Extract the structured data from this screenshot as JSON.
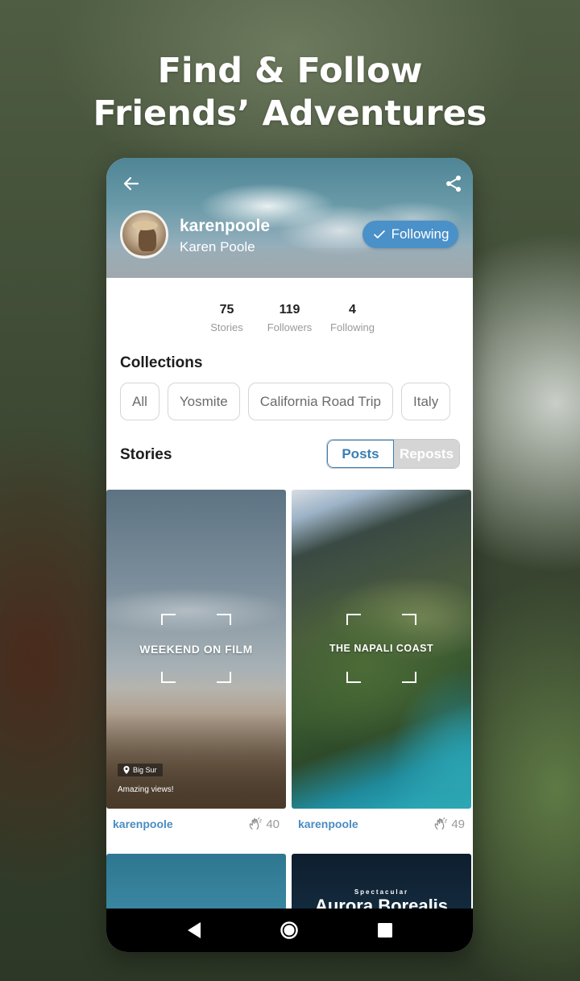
{
  "headline": {
    "line1": "Find & Follow",
    "line2": "Friends’ Adventures"
  },
  "profile": {
    "username": "karenpoole",
    "full_name": "Karen Poole",
    "follow_label": "Following"
  },
  "stats": [
    {
      "value": "75",
      "label": "Stories"
    },
    {
      "value": "119",
      "label": "Followers"
    },
    {
      "value": "4",
      "label": "Following"
    }
  ],
  "collections": {
    "title": "Collections",
    "items": [
      "All",
      "Yosmite",
      "California Road Trip",
      "Italy"
    ]
  },
  "stories": {
    "title": "Stories",
    "tab_posts": "Posts",
    "tab_reposts": "Reposts",
    "cards": [
      {
        "title": "WEEKEND ON FILM",
        "location": "Big Sur",
        "caption": "Amazing views!",
        "author": "karenpoole",
        "likes": "40"
      },
      {
        "title": "THE NAPALI COAST",
        "author": "karenpoole",
        "likes": "49"
      }
    ],
    "partial": {
      "kicker": "Spectacular",
      "title": "Aurora Borealis"
    }
  },
  "icons": {
    "back": "arrow-left-icon",
    "share": "share-icon",
    "check": "check-icon",
    "location": "location-pin-icon",
    "clap": "clap-icon",
    "nav_back": "triangle-back-icon",
    "nav_home": "circle-home-icon",
    "nav_recents": "square-recents-icon"
  },
  "colors": {
    "accent": "#4a90c9",
    "link": "#4a8cc2",
    "toggle_active": "#3a7fb3"
  }
}
